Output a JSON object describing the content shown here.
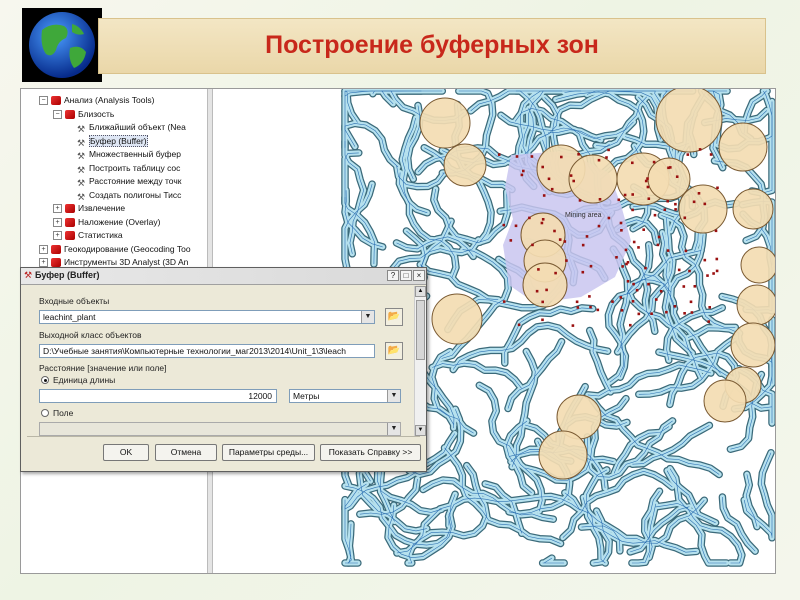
{
  "slide": {
    "title": "Построение буферных зон"
  },
  "toolbox": {
    "items": [
      {
        "label": "Анализ (Analysis Tools)",
        "kind": "toolbox",
        "expander": "−",
        "indent": 0
      },
      {
        "label": "Близость",
        "kind": "toolset",
        "expander": "−",
        "indent": 1
      },
      {
        "label": "Ближайший объект (Nea",
        "kind": "tool",
        "indent": 2
      },
      {
        "label": "Буфер (Buffer)",
        "kind": "tool",
        "indent": 2,
        "selected": true
      },
      {
        "label": "Множественный буфер",
        "kind": "tool",
        "indent": 2
      },
      {
        "label": "Построить таблицу сос",
        "kind": "tool",
        "indent": 2
      },
      {
        "label": "Расстояние между точк",
        "kind": "tool",
        "indent": 2
      },
      {
        "label": "Создать полигоны Тисс",
        "kind": "tool",
        "indent": 2
      },
      {
        "label": "Извлечение",
        "kind": "toolset",
        "expander": "+",
        "indent": 1
      },
      {
        "label": "Наложение (Overlay)",
        "kind": "toolset",
        "expander": "+",
        "indent": 1
      },
      {
        "label": "Статистика",
        "kind": "toolset",
        "expander": "+",
        "indent": 1
      },
      {
        "label": "Геокодирование (Geocoding Too",
        "kind": "toolbox",
        "expander": "+",
        "indent": 0
      },
      {
        "label": "Инструменты 3D Analyst (3D An",
        "kind": "toolbox",
        "expander": "+",
        "indent": 0
      }
    ]
  },
  "dialog": {
    "title": "Буфер (Buffer)",
    "window_buttons": {
      "help": "?",
      "restore": "□",
      "close": "×"
    },
    "input_label": "Входные объекты",
    "input_value": "leachint_plant",
    "output_label": "Выходной класс объектов",
    "output_value": "D:\\Учебные занятия\\Компьютерные технологии_маг2013\\2014\\Unit_1\\3\\leach",
    "distance_label": "Расстояние [значение или поле]",
    "radio_linear_label": "Единица длины",
    "distance_value": "12000",
    "unit_value": "Метры",
    "radio_field_label": "Поле",
    "buttons": {
      "ok": "OK",
      "cancel": "Отмена",
      "env": "Параметры среды...",
      "help": "Показать Справку >>"
    }
  },
  "map": {
    "label": "Mining area",
    "colors": {
      "river": "#b6e1ee",
      "river_outline": "#3b6a7a",
      "buffer_fill": "#f3dcb2",
      "buffer_stroke": "#7a5a32",
      "mining_area": "#c9c6f0",
      "point": "#9a1010"
    }
  }
}
